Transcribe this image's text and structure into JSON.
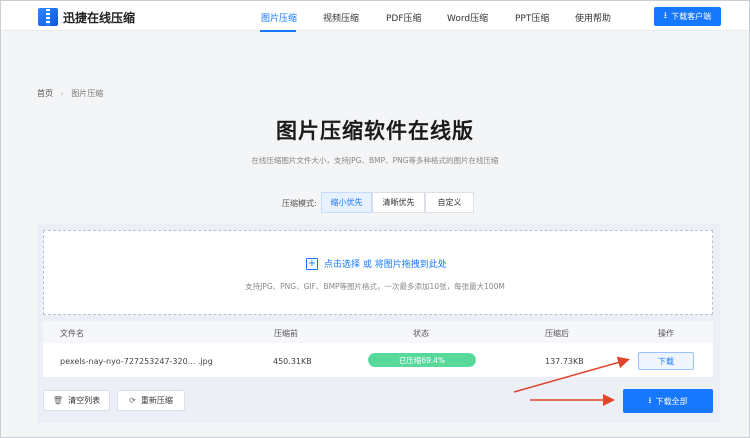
{
  "app": {
    "logo_text": "迅捷在线压缩"
  },
  "nav": {
    "items": [
      {
        "label": "图片压缩",
        "active": true
      },
      {
        "label": "视频压缩",
        "active": false
      },
      {
        "label": "PDF压缩",
        "active": false
      },
      {
        "label": "Word压缩",
        "active": false
      },
      {
        "label": "PPT压缩",
        "active": false
      },
      {
        "label": "使用帮助",
        "active": false
      }
    ],
    "download_client": "下载客户端"
  },
  "breadcrumb": {
    "home": "首页",
    "current": "图片压缩"
  },
  "hero": {
    "title": "图片压缩软件在线版",
    "subtitle": "在线压缩图片文件大小，支持JPG、BMP、PNG等多种格式的图片在线压缩"
  },
  "mode": {
    "label": "压缩模式:",
    "options": [
      {
        "label": "缩小优先",
        "selected": true
      },
      {
        "label": "清晰优先",
        "selected": false
      },
      {
        "label": "自定义",
        "selected": false
      }
    ]
  },
  "upload": {
    "action_text": "点击选择 或 将图片拖拽到此处",
    "hint": "支持JPG、PNG、GIF、BMP等图片格式，一次最多添加10张，每张最大100M"
  },
  "table": {
    "headers": [
      "文件名",
      "压缩前",
      "状态",
      "压缩后",
      "操作"
    ],
    "rows": [
      {
        "filename": "pexels-nay-nyo-727253247-320... .jpg",
        "before": "450.31KB",
        "status": "已压缩69.4%",
        "progress_percent": 100,
        "after": "137.73KB",
        "action": "下载"
      }
    ]
  },
  "actions": {
    "clear_list": "清空列表",
    "recompress": "重新压缩",
    "download_all": "下载全部"
  },
  "colors": {
    "accent": "#1677ff",
    "progress": "#58d99c",
    "annotation_arrow": "#e0452c"
  }
}
